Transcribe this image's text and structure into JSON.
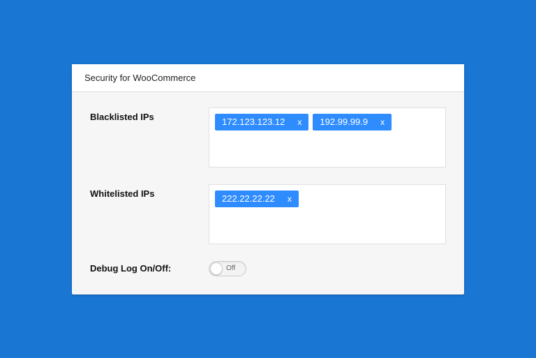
{
  "header": {
    "title": "Security for WooCommerce"
  },
  "fields": {
    "blacklist": {
      "label": "Blacklisted IPs",
      "tags": [
        "172.123.123.12",
        "192.99.99.9"
      ],
      "remove_glyph": "x"
    },
    "whitelist": {
      "label": "Whitelisted IPs",
      "tags": [
        "222.22.22.22"
      ],
      "remove_glyph": "x"
    },
    "debug": {
      "label": "Debug Log On/Off:",
      "state_text": "Off"
    }
  }
}
